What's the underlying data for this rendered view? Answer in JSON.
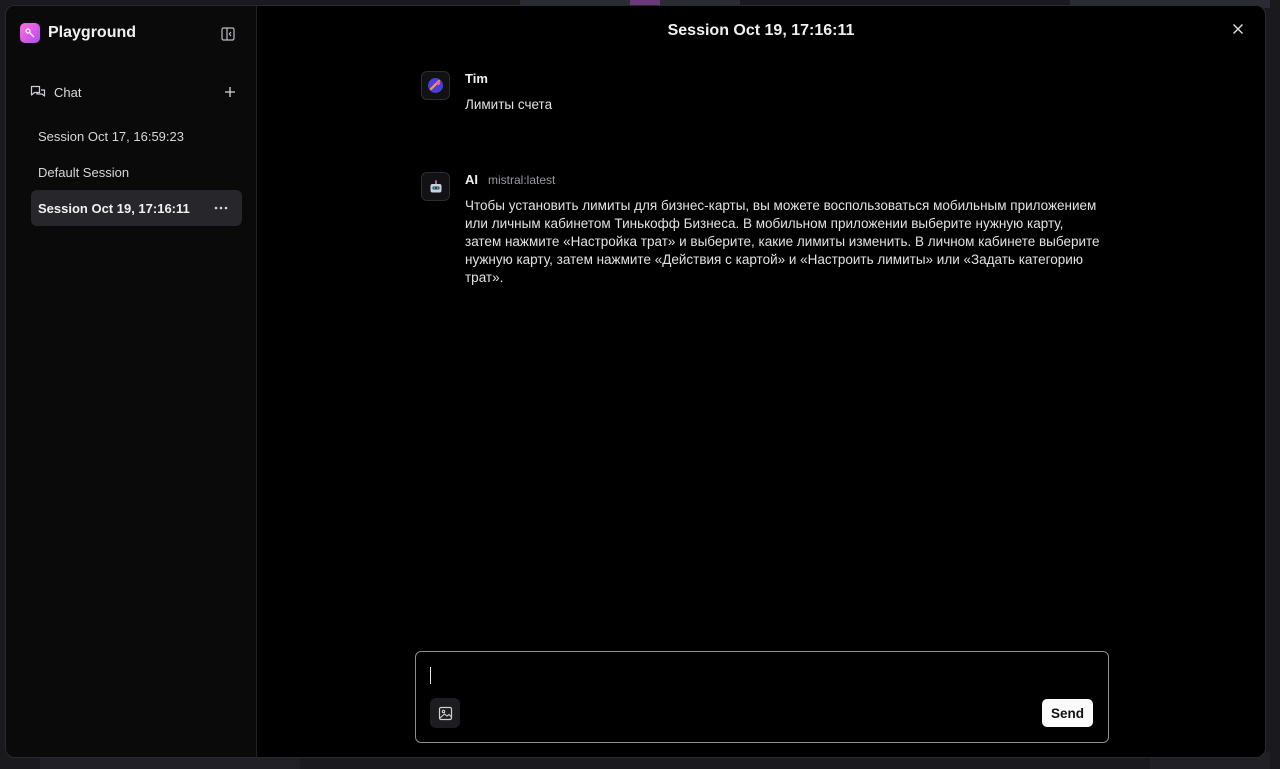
{
  "app": {
    "title": "Playground"
  },
  "sidebar": {
    "chat_label": "Chat",
    "sessions": [
      {
        "label": "Session Oct 17, 16:59:23",
        "active": false
      },
      {
        "label": "Default Session",
        "active": false
      },
      {
        "label": "Session Oct 19, 17:16:11",
        "active": true
      }
    ]
  },
  "main": {
    "title": "Session Oct 19, 17:16:11",
    "messages": [
      {
        "author": "Tim",
        "model": "",
        "text": "Лимиты счета"
      },
      {
        "author": "AI",
        "model": "mistral:latest",
        "text": "Чтобы установить лимиты для бизнес-карты, вы можете воспользоваться мобильным приложением или личным кабинетом Тинькофф Бизнеса. В мобильном приложении выберите нужную карту, затем нажмите «Настройка трат» и выберите, какие лимиты изменить. В личном кабинете выберите нужную карту, затем нажмите «Действия с картой» и «Настроить лимиты» или «Задать категорию трат»."
      }
    ]
  },
  "composer": {
    "value": "",
    "send_label": "Send"
  },
  "colors": {
    "accent": "#c153ee",
    "background": "#000000",
    "active_session": "#27272b"
  },
  "icons": {
    "brand": "playground-logo-icon",
    "collapse": "sidebar-collapse-icon",
    "chat": "chat-bubbles-icon",
    "new_chat": "plus-icon",
    "more": "ellipsis-icon",
    "close": "close-icon",
    "image": "image-icon"
  }
}
